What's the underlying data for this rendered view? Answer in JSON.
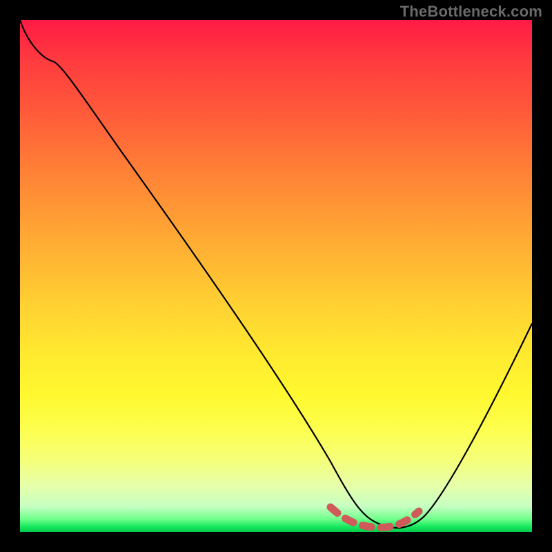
{
  "watermark": "TheBottleneck.com",
  "colors": {
    "background": "#000000",
    "line": "#000000",
    "trough_dash": "#cf5a5a",
    "watermark_text": "#6a6a6a"
  },
  "chart_data": {
    "type": "line",
    "title": "",
    "xlabel": "",
    "ylabel": "",
    "xlim": [
      0,
      100
    ],
    "ylim": [
      0,
      100
    ],
    "x": [
      0,
      3,
      7,
      20,
      40,
      55,
      62,
      66,
      70,
      74,
      78,
      82,
      90,
      100
    ],
    "values": [
      100,
      97,
      93,
      75,
      47,
      26,
      12,
      4,
      1,
      0.5,
      1,
      4,
      18,
      45
    ],
    "annotations": [
      {
        "kind": "trough-highlight",
        "x_start": 62,
        "x_end": 80
      }
    ]
  }
}
